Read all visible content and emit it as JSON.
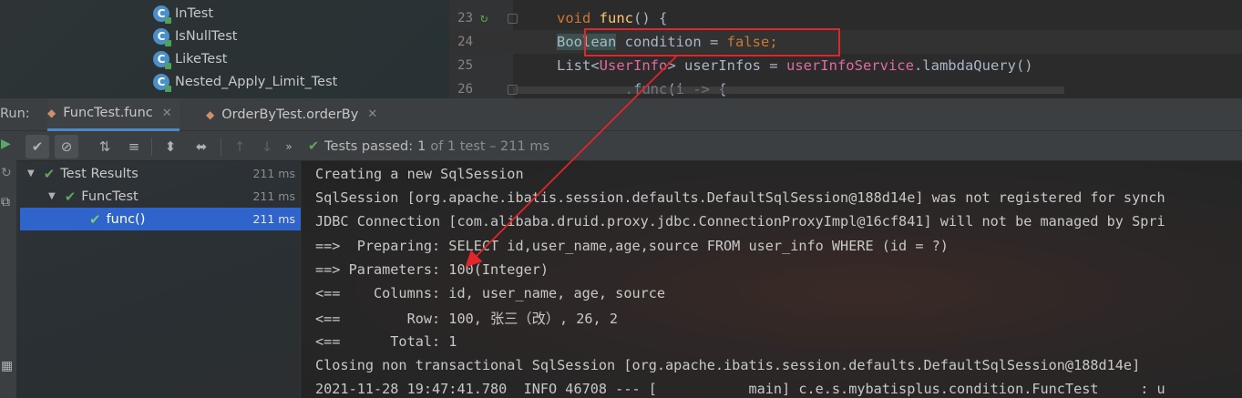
{
  "project_tree": {
    "items": [
      {
        "icon": "class-icon",
        "label": "InTest"
      },
      {
        "icon": "class-icon",
        "label": "IsNullTest"
      },
      {
        "icon": "class-icon",
        "label": "LikeTest"
      },
      {
        "icon": "class-icon",
        "label": "Nested_Apply_Limit_Test"
      }
    ]
  },
  "editor": {
    "lines": [
      {
        "number": "23",
        "tokens": [
          {
            "t": "void ",
            "c": "kw"
          },
          {
            "t": "func",
            "c": "fn"
          },
          {
            "t": "() {",
            "c": "ident"
          }
        ]
      },
      {
        "number": "24",
        "tokens": [
          {
            "t": "Boolean",
            "c": "ident type-hl"
          },
          {
            "t": " condition = ",
            "c": "ident"
          },
          {
            "t": "false",
            "c": "kw"
          },
          {
            "t": ";",
            "c": "kw"
          }
        ]
      },
      {
        "number": "25",
        "tokens": [
          {
            "t": "List<",
            "c": "ident"
          },
          {
            "t": "UserInfo",
            "c": "pink"
          },
          {
            "t": "> userInfos = ",
            "c": "ident"
          },
          {
            "t": "userInfoService",
            "c": "pink"
          },
          {
            "t": ".lambdaQuery()",
            "c": "ident"
          }
        ]
      },
      {
        "number": "26",
        "tokens": [
          {
            "t": "        .func(i -> {",
            "c": "ident"
          }
        ]
      }
    ],
    "highlighted_line": "Boolean condition = false;"
  },
  "run_bar": {
    "label": "Run:",
    "tabs": [
      {
        "label": "FuncTest.func",
        "active": true
      },
      {
        "label": "OrderByTest.orderBy",
        "active": false
      }
    ]
  },
  "toolbar": {
    "buttons": [
      "run-icon",
      "show-passed-icon",
      "show-ignored-icon",
      "sort-alpha-icon",
      "sort-duration-icon",
      "expand-all-icon",
      "collapse-all-icon",
      "prev-failed-icon",
      "next-failed-icon",
      "more-icon"
    ],
    "status_label": "Tests passed:",
    "status_count": "1",
    "status_detail": "of 1 test – 211 ms"
  },
  "results_tree": {
    "rows": [
      {
        "label": "Test Results",
        "time": "211 ms",
        "level": 0,
        "expanded": true
      },
      {
        "label": "FuncTest",
        "time": "211 ms",
        "level": 1,
        "expanded": true
      },
      {
        "label": "func()",
        "time": "211 ms",
        "level": 2,
        "selected": true
      }
    ]
  },
  "console": {
    "lines": [
      "Creating a new SqlSession",
      "SqlSession [org.apache.ibatis.session.defaults.DefaultSqlSession@188d14e] was not registered for synch",
      "JDBC Connection [com.alibaba.druid.proxy.jdbc.ConnectionProxyImpl@16cf841] will not be managed by Spri",
      "==>  Preparing: SELECT id,user_name,age,source FROM user_info WHERE (id = ?)",
      "==> Parameters: 100(Integer)",
      "<==    Columns: id, user_name, age, source",
      "<==        Row: 100, 张三（改）, 26, 2",
      "<==      Total: 1",
      "Closing non transactional SqlSession [org.apache.ibatis.session.defaults.DefaultSqlSession@188d14e]",
      "2021-11-28 19:47:41.780  INFO 46708 --- [           main] c.e.s.mybatisplus.condition.FuncTest     : u"
    ]
  },
  "colors": {
    "annotation_red": "#e0262b",
    "pass_green": "#5fa65a",
    "selection_blue": "#2f65ca",
    "tab_underline": "#4a88c7"
  }
}
